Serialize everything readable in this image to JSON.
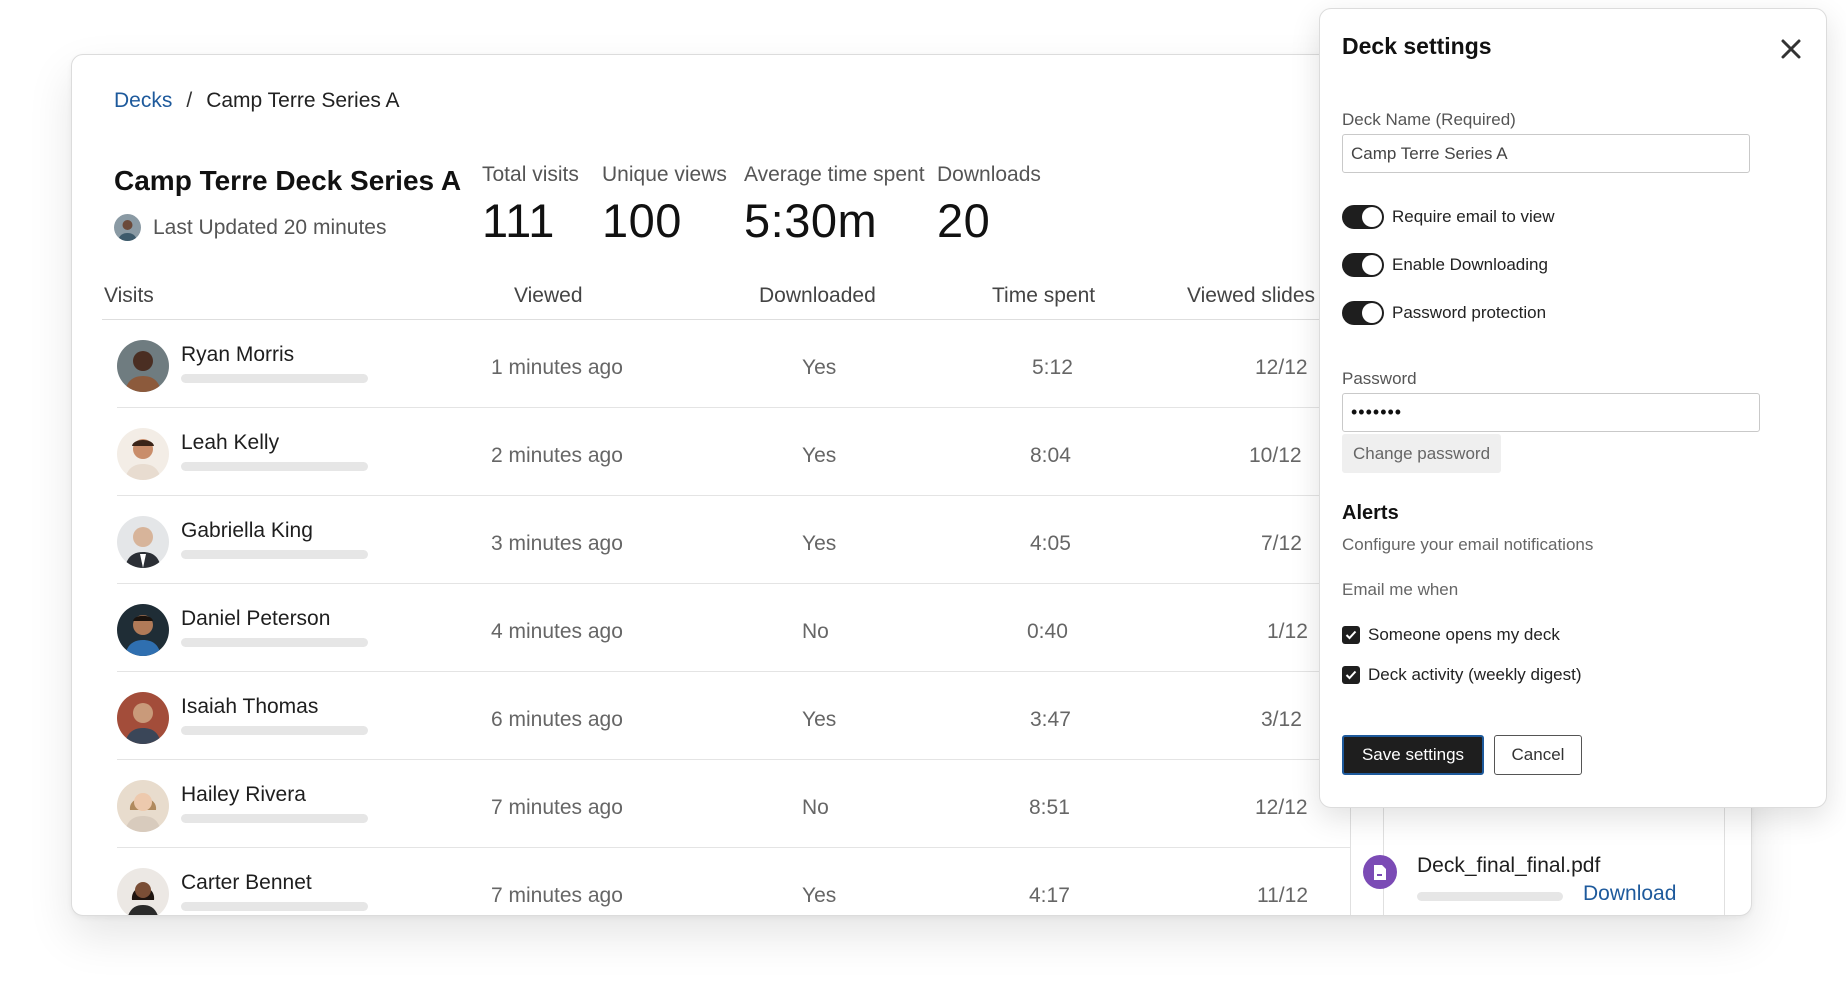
{
  "breadcrumb": {
    "parent": "Decks",
    "separator": "/",
    "current": "Camp Terre Series A"
  },
  "deck": {
    "title": "Camp Terre Deck Series A",
    "last_updated": "Last Updated 20 minutes"
  },
  "stats": [
    {
      "label": "Total visits",
      "value": "111"
    },
    {
      "label": "Unique views",
      "value": "100"
    },
    {
      "label": "Average time spent",
      "value": "5:30m"
    },
    {
      "label": "Downloads",
      "value": "20"
    }
  ],
  "table": {
    "headers": {
      "visits": "Visits",
      "viewed": "Viewed",
      "downloaded": "Downloaded",
      "time_spent": "Time spent",
      "viewed_slides": "Viewed slides"
    },
    "rows": [
      {
        "name": "Ryan Morris",
        "viewed": "1 minutes ago",
        "downloaded": "Yes",
        "time": "5:12",
        "slides": "12/12"
      },
      {
        "name": "Leah Kelly",
        "viewed": "2 minutes ago",
        "downloaded": "Yes",
        "time": "8:04",
        "slides": "10/12"
      },
      {
        "name": "Gabriella King",
        "viewed": "3 minutes ago",
        "downloaded": "Yes",
        "time": "4:05",
        "slides": "7/12"
      },
      {
        "name": "Daniel Peterson",
        "viewed": "4 minutes ago",
        "downloaded": "No",
        "time": "0:40",
        "slides": "1/12"
      },
      {
        "name": "Isaiah Thomas",
        "viewed": "6 minutes ago",
        "downloaded": "Yes",
        "time": "3:47",
        "slides": "3/12"
      },
      {
        "name": "Hailey Rivera",
        "viewed": "7 minutes ago",
        "downloaded": "No",
        "time": "8:51",
        "slides": "12/12"
      },
      {
        "name": "Carter Bennet",
        "viewed": "7 minutes ago",
        "downloaded": "Yes",
        "time": "4:17",
        "slides": "11/12"
      }
    ]
  },
  "file": {
    "name": "Deck_final_final.pdf",
    "download_label": "Download",
    "icon": "file-icon"
  },
  "settings": {
    "title": "Deck settings",
    "deck_name_label": "Deck Name (Required)",
    "deck_name_value": "Camp Terre Series A",
    "toggles": [
      {
        "label": "Require email to view",
        "on": true
      },
      {
        "label": "Enable Downloading",
        "on": true
      },
      {
        "label": "Password protection",
        "on": true
      }
    ],
    "password_label": "Password",
    "password_value": "•••••••",
    "change_password_label": "Change password",
    "alerts_title": "Alerts",
    "alerts_subtitle": "Configure your email notifications",
    "email_me_when": "Email me when",
    "checkboxes": [
      {
        "label": "Someone opens my deck",
        "checked": true
      },
      {
        "label": "Deck activity (weekly digest)",
        "checked": true
      }
    ],
    "save_label": "Save settings",
    "cancel_label": "Cancel"
  },
  "colors": {
    "link": "#1e5a9c",
    "dark": "#1e1e1e",
    "file_icon": "#7b4bb5"
  }
}
